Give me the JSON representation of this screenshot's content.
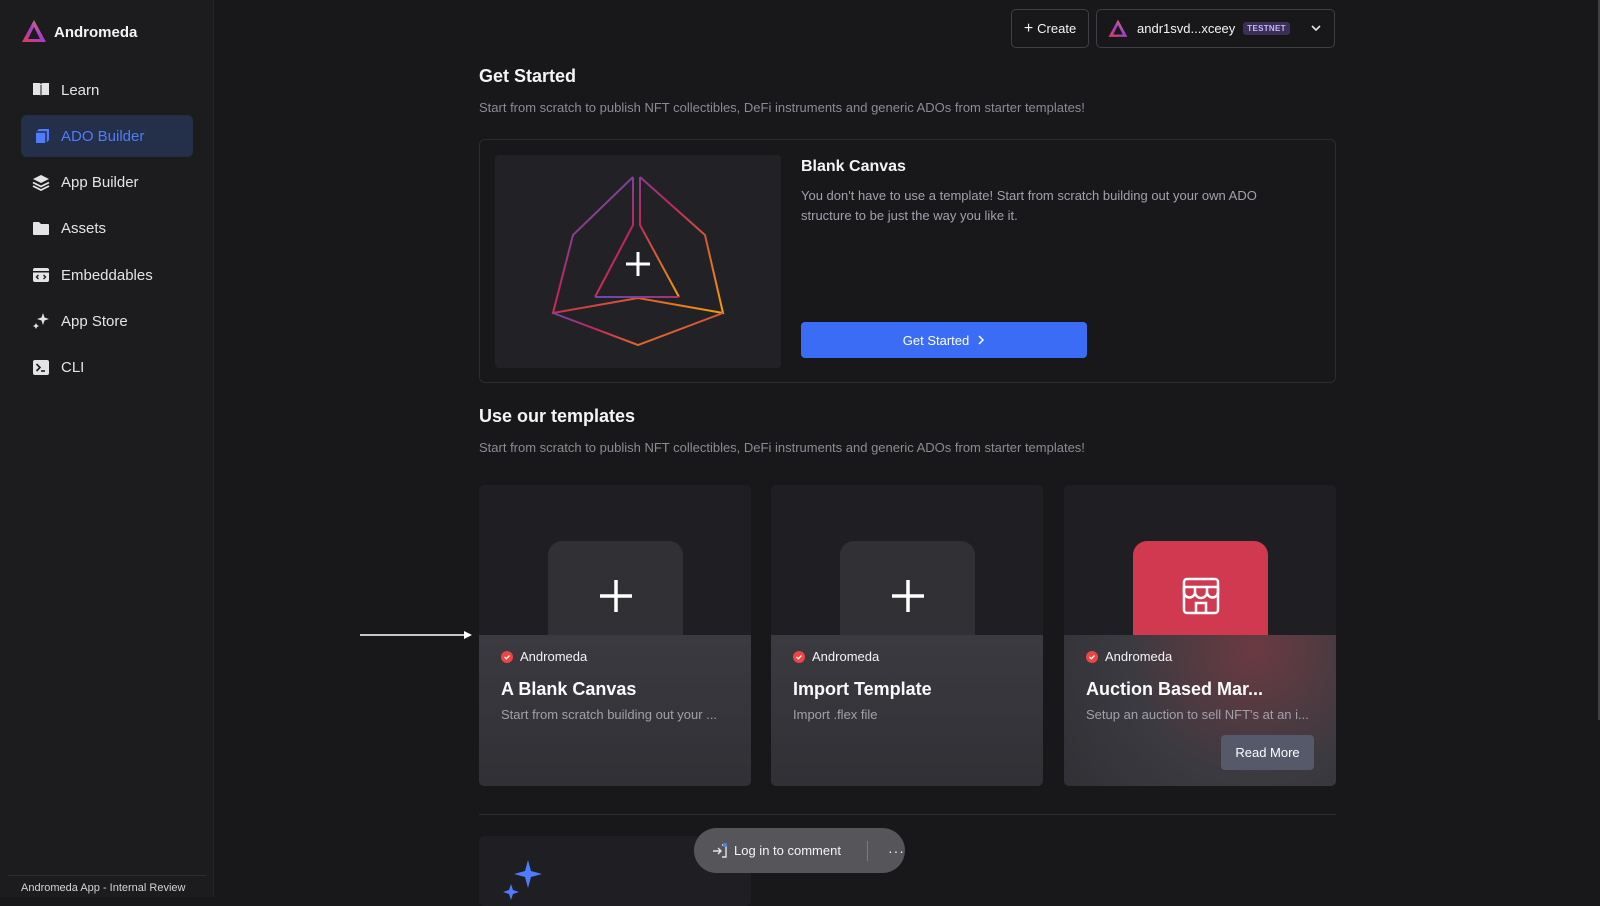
{
  "app": {
    "name": "Andromeda",
    "footer": "Andromeda App - Internal Review"
  },
  "sidebar": {
    "items": [
      {
        "label": "Learn",
        "icon": "book-icon",
        "active": false
      },
      {
        "label": "ADO Builder",
        "icon": "cube-icon",
        "active": true
      },
      {
        "label": "App Builder",
        "icon": "layers-icon",
        "active": false
      },
      {
        "label": "Assets",
        "icon": "folder-icon",
        "active": false
      },
      {
        "label": "Embeddables",
        "icon": "embed-icon",
        "active": false
      },
      {
        "label": "App Store",
        "icon": "sparkle-icon",
        "active": false
      },
      {
        "label": "CLI",
        "icon": "terminal-icon",
        "active": false
      }
    ]
  },
  "topbar": {
    "create_label": "Create",
    "wallet_address": "andr1svd...xceey",
    "wallet_network": "TESTNET"
  },
  "get_started": {
    "title": "Get Started",
    "subtitle": "Start from scratch to publish NFT collectibles, DeFi instruments and generic ADOs from starter templates!",
    "card": {
      "title": "Blank Canvas",
      "description": "You don't have to use a template! Start from scratch building out your own ADO structure to be just the way you like it.",
      "button_label": "Get Started"
    }
  },
  "templates": {
    "title": "Use our templates",
    "subtitle": "Start from scratch to publish NFT collectibles, DeFi instruments and generic ADOs from starter templates!",
    "cards": [
      {
        "author": "Andromeda",
        "title": "A Blank Canvas",
        "description": "Start from scratch building out your ...",
        "icon": "plus-icon"
      },
      {
        "author": "Andromeda",
        "title": "Import Template",
        "description": "Import .flex file",
        "icon": "plus-icon"
      },
      {
        "author": "Andromeda",
        "title": "Auction Based Mar...",
        "description": "Setup an auction to sell NFT's at an i...",
        "icon": "storefront-icon",
        "read_more": "Read More",
        "tile_color": "#d0394f"
      }
    ]
  },
  "comment": {
    "label": "Log in to comment",
    "more": "···"
  },
  "colors": {
    "accent": "#3b6cf6",
    "active_nav_bg": "#24304a",
    "active_nav_text": "#4f7bff",
    "verified": "#ef4444"
  }
}
